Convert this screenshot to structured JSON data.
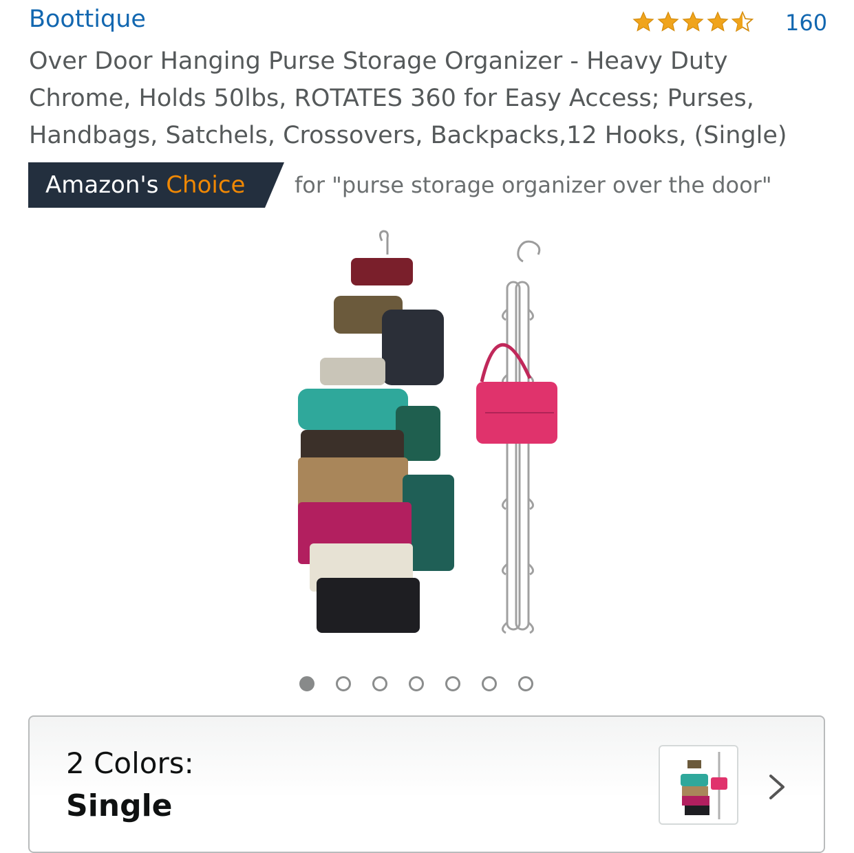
{
  "brand": "Boottique",
  "rating": {
    "stars": 4.5,
    "review_count": "160",
    "star_color": "#f0a41c"
  },
  "title": "Over Door Hanging Purse Storage Organizer - Heavy Duty Chrome, Holds 50lbs, ROTATES 360 for Easy Access; Purses, Handbags, Satchels, Crossovers, Backpacks,12 Hooks, (Single)",
  "badge": {
    "prefix": "Amazon's",
    "choice": "Choice",
    "query": "for \"purse storage organizer over the door\"",
    "background": "#232f3e",
    "accent": "#f08804"
  },
  "gallery": {
    "image_count": 7,
    "active_index": 0
  },
  "variation": {
    "label": "2 Colors:",
    "value": "Single",
    "chevron_icon": "chevron-right-icon"
  }
}
